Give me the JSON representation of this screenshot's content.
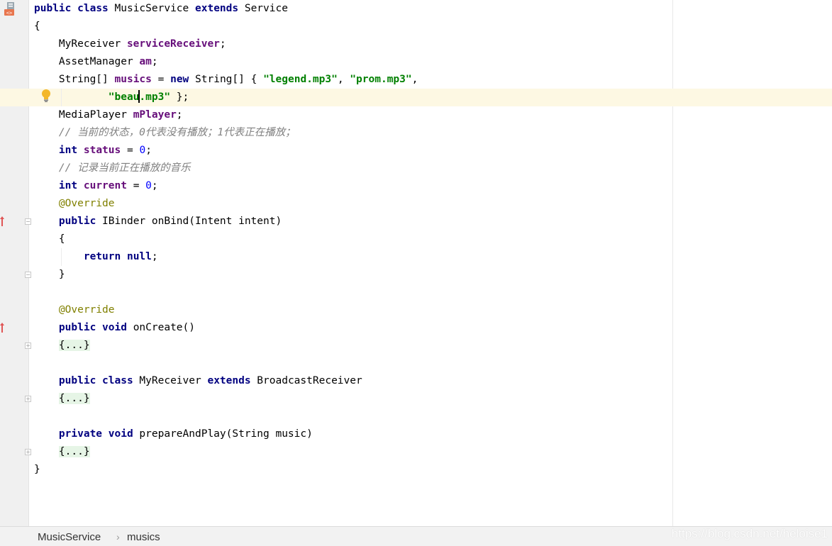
{
  "code_lines": [
    {
      "top": 0,
      "parts": [
        {
          "t": "public",
          "c": "kw"
        },
        {
          "t": " "
        },
        {
          "t": "class",
          "c": "kw"
        },
        {
          "t": " MusicService "
        },
        {
          "t": "extends",
          "c": "kw"
        },
        {
          "t": " Service"
        }
      ]
    },
    {
      "parts": [
        {
          "t": "{"
        }
      ]
    },
    {
      "parts": [
        {
          "t": "    MyReceiver "
        },
        {
          "t": "serviceReceiver",
          "c": "field"
        },
        {
          "t": ";"
        }
      ]
    },
    {
      "parts": [
        {
          "t": "    AssetManager "
        },
        {
          "t": "am",
          "c": "field"
        },
        {
          "t": ";"
        }
      ]
    },
    {
      "parts": [
        {
          "t": "    String[] "
        },
        {
          "t": "musics",
          "c": "field"
        },
        {
          "t": " = "
        },
        {
          "t": "new",
          "c": "kw"
        },
        {
          "t": " String[] { "
        },
        {
          "t": "\"legend.mp3\"",
          "c": "str"
        },
        {
          "t": ", "
        },
        {
          "t": "\"prom.mp3\"",
          "c": "str"
        },
        {
          "t": ","
        }
      ]
    },
    {
      "parts": [
        {
          "t": "            "
        },
        {
          "t": "\"beau",
          "c": "str"
        },
        {
          "t": "",
          "c": "caret"
        },
        {
          "t": ".mp3\"",
          "c": "str"
        },
        {
          "t": " };"
        }
      ]
    },
    {
      "parts": [
        {
          "t": "    MediaPlayer "
        },
        {
          "t": "mPlayer",
          "c": "field"
        },
        {
          "t": ";"
        }
      ]
    },
    {
      "parts": [
        {
          "t": "    // 当前的状态，0代表没有播放；1代表正在播放；",
          "c": "cmt"
        }
      ]
    },
    {
      "parts": [
        {
          "t": "    "
        },
        {
          "t": "int",
          "c": "kw"
        },
        {
          "t": " "
        },
        {
          "t": "status",
          "c": "field"
        },
        {
          "t": " = "
        },
        {
          "t": "0",
          "c": "num"
        },
        {
          "t": ";"
        }
      ]
    },
    {
      "parts": [
        {
          "t": "    // 记录当前正在播放的音乐",
          "c": "cmt"
        }
      ]
    },
    {
      "parts": [
        {
          "t": "    "
        },
        {
          "t": "int",
          "c": "kw"
        },
        {
          "t": " "
        },
        {
          "t": "current",
          "c": "field"
        },
        {
          "t": " = "
        },
        {
          "t": "0",
          "c": "num"
        },
        {
          "t": ";"
        }
      ]
    },
    {
      "parts": [
        {
          "t": "    "
        },
        {
          "t": "@Override",
          "c": "ann"
        }
      ]
    },
    {
      "parts": [
        {
          "t": "    "
        },
        {
          "t": "public",
          "c": "kw"
        },
        {
          "t": " IBinder onBind(Intent intent)"
        }
      ]
    },
    {
      "parts": [
        {
          "t": "    {"
        }
      ]
    },
    {
      "parts": [
        {
          "t": "        "
        },
        {
          "t": "return",
          "c": "kw"
        },
        {
          "t": " "
        },
        {
          "t": "null",
          "c": "kw"
        },
        {
          "t": ";"
        }
      ]
    },
    {
      "parts": [
        {
          "t": "    }"
        }
      ]
    },
    {
      "parts": [
        {
          "t": ""
        }
      ]
    },
    {
      "parts": [
        {
          "t": "    "
        },
        {
          "t": "@Override",
          "c": "ann"
        }
      ]
    },
    {
      "parts": [
        {
          "t": "    "
        },
        {
          "t": "public",
          "c": "kw"
        },
        {
          "t": " "
        },
        {
          "t": "void",
          "c": "kw"
        },
        {
          "t": " onCreate()"
        }
      ]
    },
    {
      "parts": [
        {
          "t": "    "
        },
        {
          "t": "{...}",
          "c": "fold-region"
        }
      ]
    },
    {
      "parts": [
        {
          "t": ""
        }
      ]
    },
    {
      "parts": [
        {
          "t": "    "
        },
        {
          "t": "public",
          "c": "kw"
        },
        {
          "t": " "
        },
        {
          "t": "class",
          "c": "kw"
        },
        {
          "t": " MyReceiver "
        },
        {
          "t": "extends",
          "c": "kw"
        },
        {
          "t": " BroadcastReceiver"
        }
      ]
    },
    {
      "parts": [
        {
          "t": "    "
        },
        {
          "t": "{...}",
          "c": "fold-region"
        }
      ]
    },
    {
      "parts": [
        {
          "t": ""
        }
      ]
    },
    {
      "parts": [
        {
          "t": "    "
        },
        {
          "t": "private",
          "c": "kw"
        },
        {
          "t": " "
        },
        {
          "t": "void",
          "c": "kw"
        },
        {
          "t": " prepareAndPlay(String music)"
        }
      ]
    },
    {
      "parts": [
        {
          "t": "    "
        },
        {
          "t": "{...}",
          "c": "fold-region"
        }
      ]
    },
    {
      "parts": [
        {
          "t": "}"
        }
      ]
    }
  ],
  "breadcrumb": {
    "class_name": "MusicService",
    "separator": "›",
    "member_name": "musics"
  },
  "watermark": "https://blog.csdn.net/heloise1",
  "icons": {
    "file": "java-file-icon",
    "intention": "lightbulb-icon",
    "override": "override-arrow-icon",
    "fold": "fold-toggle-icon"
  },
  "colors": {
    "keyword": "#000080",
    "field": "#660e7a",
    "string": "#008000",
    "number": "#0000ff",
    "comment": "#808080",
    "annotation": "#808000",
    "current_line": "#fdf8e3"
  }
}
